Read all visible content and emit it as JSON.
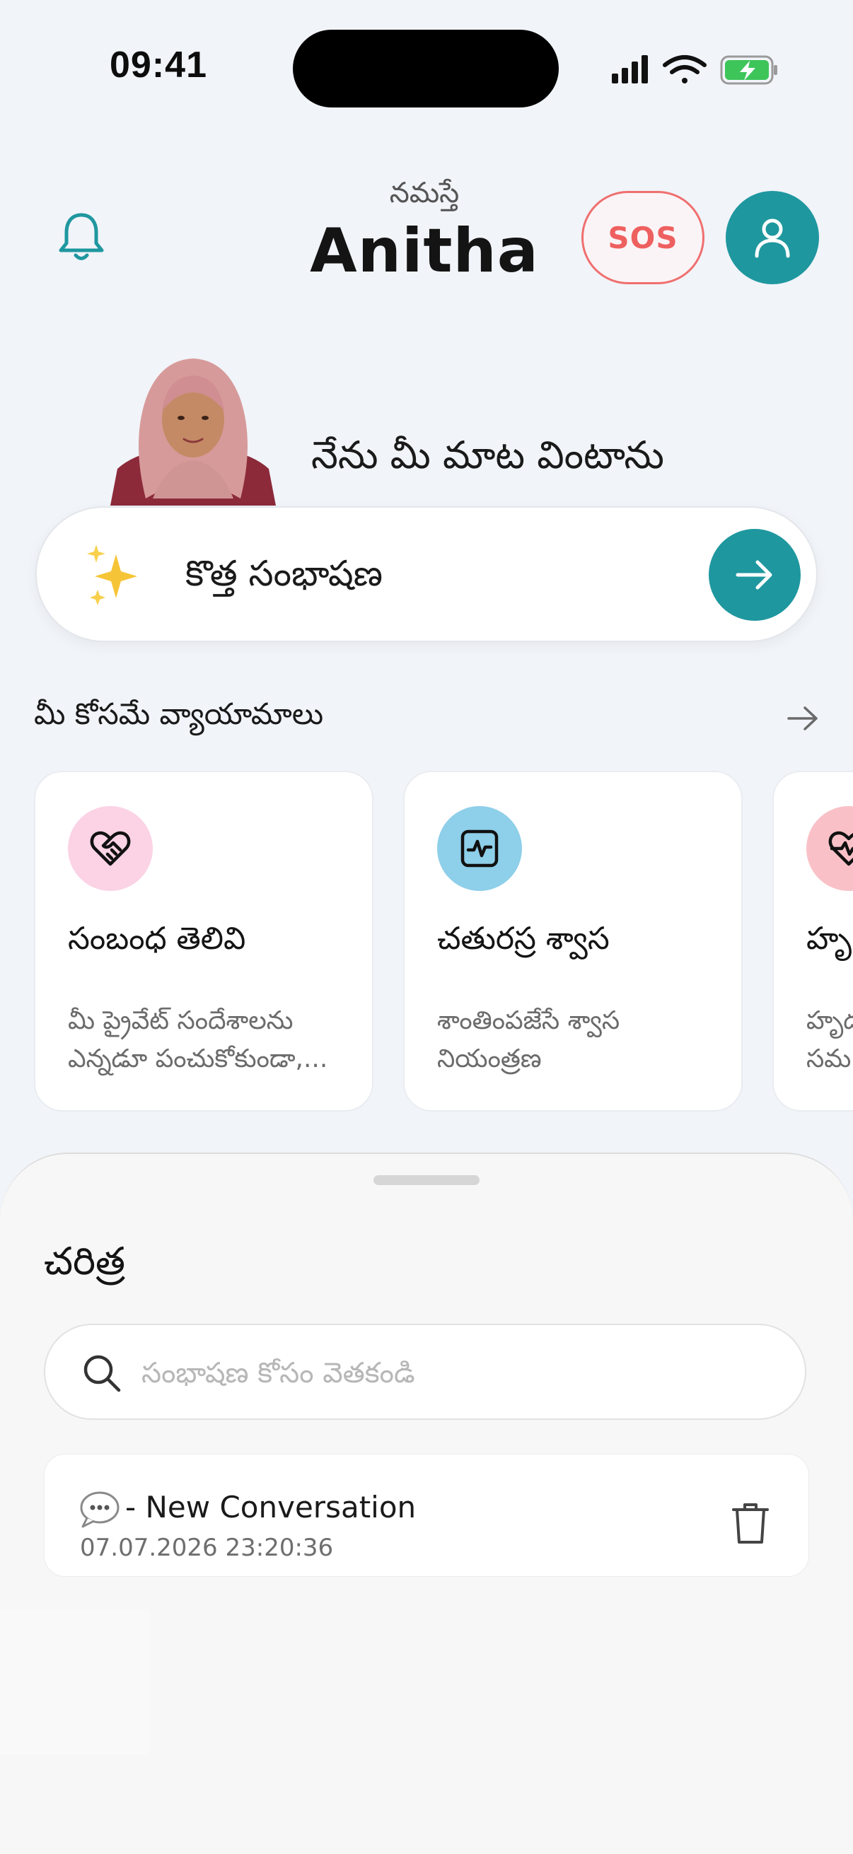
{
  "status_bar": {
    "time": "09:41"
  },
  "header": {
    "greeting": "నమస్తే",
    "user_name": "Anitha",
    "sos_label": "SOS"
  },
  "companion": {
    "listen_text": "నేను మీ మాట వింటాను"
  },
  "new_conversation": {
    "label": "కొత్త సంభాషణ"
  },
  "exercises": {
    "title": "మీ కోసమే వ్యాయామాలు",
    "cards": [
      {
        "name": "సంబంధ తెలివి",
        "desc_line1": "మీ ప్రైవేట్ సందేశాలను",
        "desc_line2": "ఎన్నడూ పంచుకోకుండా,...",
        "icon": "heart-handshake-icon",
        "icon_bg": "#fbd3e5"
      },
      {
        "name": "చతురస్ర శ్వాస",
        "desc_line1": "శాంతింపజేసే శ్వాస",
        "desc_line2": "నియంత్రణ",
        "icon": "activity-square-icon",
        "icon_bg": "#8ecfe9"
      },
      {
        "name": "హృ",
        "desc_line1": "హృద",
        "desc_line2": "సమ",
        "icon": "heart-pulse-icon",
        "icon_bg": "#f9c1c7"
      }
    ]
  },
  "history": {
    "title": "చరిత్ర",
    "search_placeholder": "సంభాషణ కోసం వెతకండి",
    "items": [
      {
        "title": "- New Conversation",
        "timestamp": "07.07.2026 23:20:36"
      }
    ]
  },
  "colors": {
    "accent": "#1f979f",
    "sos": "#ee6060",
    "background": "#f1f4f9"
  }
}
